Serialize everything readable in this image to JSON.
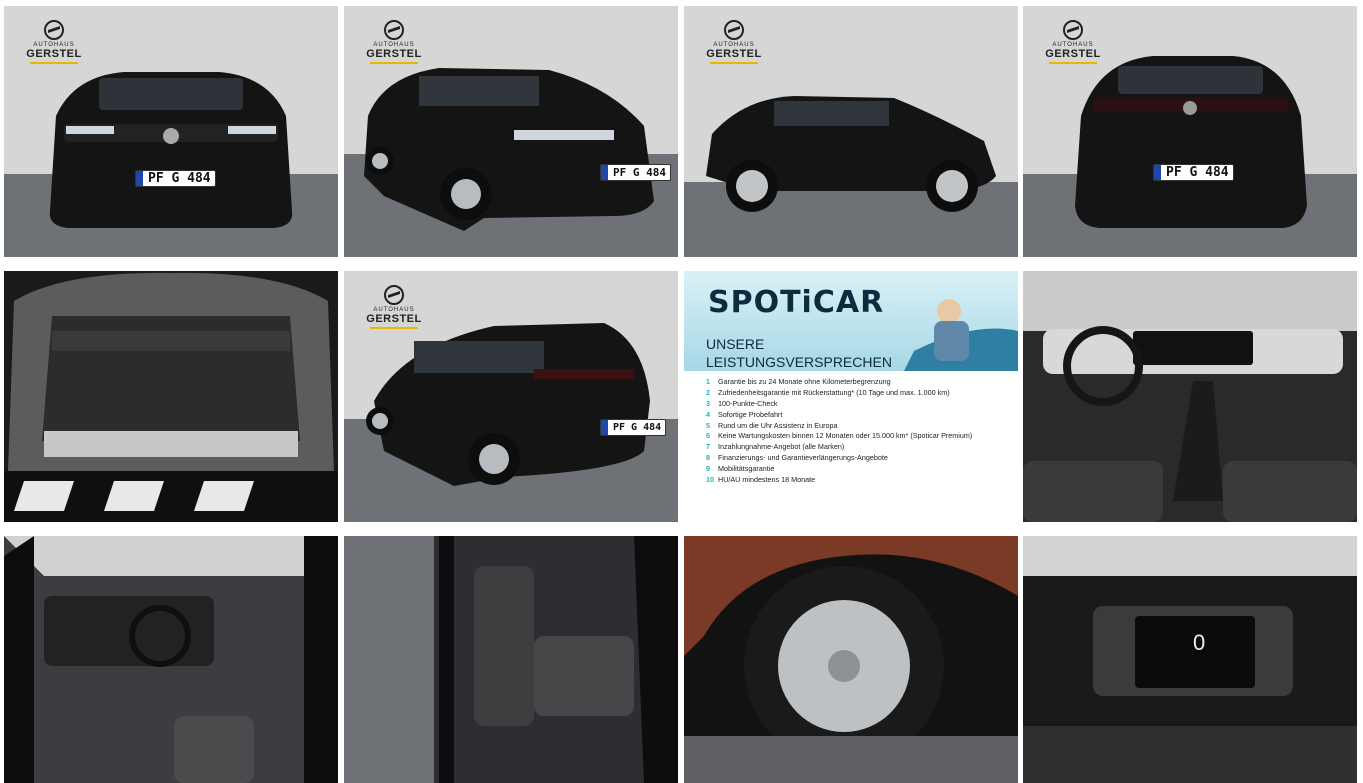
{
  "gallery": {
    "images": [
      {
        "label": "Front view"
      },
      {
        "label": "Front left three-quarter view"
      },
      {
        "label": "Left side view"
      },
      {
        "label": "Rear view"
      },
      {
        "label": "Trunk"
      },
      {
        "label": "Rear left three-quarter view"
      },
      {
        "label": "Spoticar service promise"
      },
      {
        "label": "Cockpit"
      },
      {
        "label": "Driver door open"
      },
      {
        "label": "Rear door open"
      },
      {
        "label": "Wheel"
      },
      {
        "label": "Instrument cluster"
      }
    ]
  },
  "dealer_logo": {
    "top_line": "AUTOHAUS",
    "name": "GERSTEL"
  },
  "plate_text": "PF G 484",
  "spoticar": {
    "brand": "SPOTiCAR",
    "headline_1": "UNSERE",
    "headline_2": "LEISTUNGSVERSPRECHEN",
    "items": [
      {
        "n": "1",
        "text": "Garantie bis zu 24 Monate ohne Kilometerbegrenzung"
      },
      {
        "n": "2",
        "text": "Zufriedenheitsgarantie mit Rückerstattung* (10 Tage und max. 1.000 km)"
      },
      {
        "n": "3",
        "text": "100-Punkte-Check"
      },
      {
        "n": "4",
        "text": "Sofortige Probefahrt"
      },
      {
        "n": "5",
        "text": "Rund um die Uhr Assistenz in Europa"
      },
      {
        "n": "6",
        "text": "Keine Wartungskosten binnen 12 Monaten oder 15.000 km* (Spoticar Premium)"
      },
      {
        "n": "7",
        "text": "Inzahlungnahme-Angebot (alle Marken)"
      },
      {
        "n": "8",
        "text": "Finanzierungs- und Garantieverlängerungs-Angebote"
      },
      {
        "n": "9",
        "text": "Mobilitätsgarantie"
      },
      {
        "n": "10",
        "text": "HU/AU mindestens 18 Monate"
      }
    ]
  },
  "cluster": {
    "speed": "0"
  },
  "colors": {
    "accent": "#1fb3c7",
    "wall": "#d8d8d8",
    "floor": "#6f7276",
    "car": "#141414"
  }
}
